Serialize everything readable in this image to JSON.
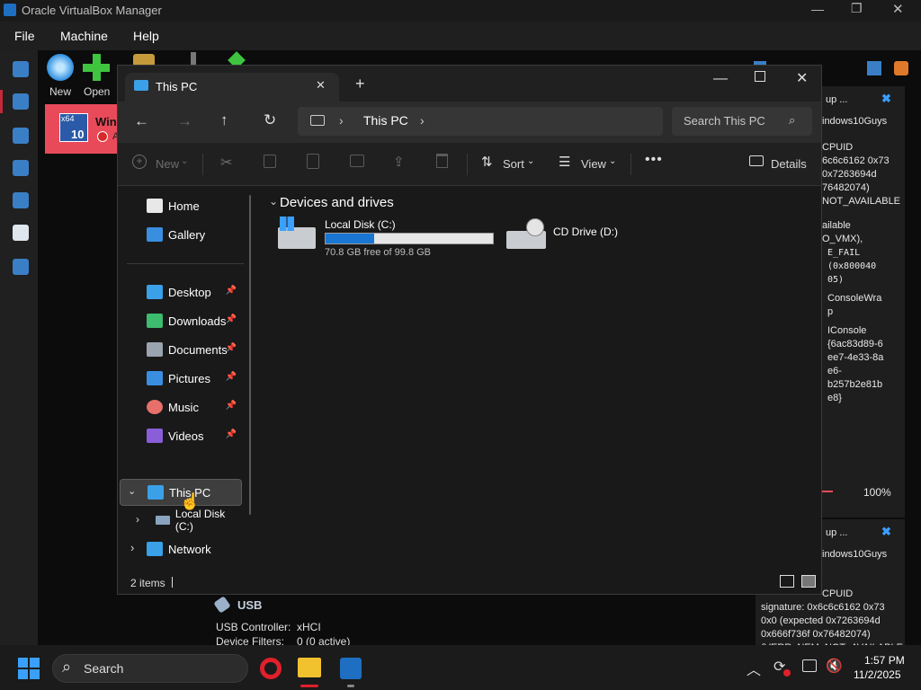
{
  "vbox": {
    "title": "Oracle VirtualBox Manager",
    "menu": [
      "File",
      "Machine",
      "Help"
    ],
    "toolbar": {
      "new_label": "New",
      "open_label": "Open"
    },
    "vm": {
      "badge_top": "x64",
      "badge_num": "10",
      "name_partial": "Wind",
      "state_partial": "A"
    },
    "right_panel_top": {
      "heading": "up ...",
      "lines": [
        "indows10Guys",
        "",
        "CPUID",
        "6c6c6162 0x73",
        "0x7263694d",
        "76482074)",
        "NOT_AVAILABLE",
        "",
        "ailable",
        "O_VMX),"
      ],
      "mono_lines": [
        "E_FAIL",
        "(0x800040",
        "05)"
      ],
      "lines2": [
        "ConsoleWra",
        "p",
        "",
        "IConsole",
        "{6ac83d89-6",
        "ee7-4e33-8a",
        "e6-",
        "b257b2e81b",
        "e8}"
      ],
      "percent": "100%"
    },
    "right_panel_bottom": {
      "heading": "up ...",
      "lines": [
        "indows10Guys",
        "",
        "CPUID",
        "signature: 0x6c6c6162 0x73",
        "0x0 (expected 0x7263694d",
        "0x666f736f 0x76482074)",
        "(VERR_NEM_NOT_AVAILABLE"
      ]
    },
    "usb": {
      "title": "USB",
      "controller_label": "USB Controller:",
      "controller_value": "xHCI",
      "filters_label": "Device Filters:",
      "filters_value": "0 (0 active)"
    }
  },
  "explorer": {
    "tab_title": "This PC",
    "address": {
      "segment": "This PC"
    },
    "search_placeholder": "Search This PC",
    "commands": {
      "new": "New",
      "sort": "Sort",
      "view": "View",
      "details": "Details"
    },
    "nav": {
      "home": "Home",
      "gallery": "Gallery",
      "quick": [
        {
          "label": "Desktop",
          "icon": "desktop-icon",
          "color": "#3aa0e8"
        },
        {
          "label": "Downloads",
          "icon": "download-icon",
          "color": "#3dbb6e"
        },
        {
          "label": "Documents",
          "icon": "document-icon",
          "color": "#9aa4b0"
        },
        {
          "label": "Pictures",
          "icon": "picture-icon",
          "color": "#3a8ee0"
        },
        {
          "label": "Music",
          "icon": "music-icon",
          "color": "#e8706a"
        },
        {
          "label": "Videos",
          "icon": "video-icon",
          "color": "#8a5ed8"
        }
      ],
      "this_pc": "This PC",
      "local_disk": "Local Disk (C:)",
      "network": "Network"
    },
    "section_title": "Devices and drives",
    "drives": [
      {
        "name": "Local Disk (C:)",
        "free_text": "70.8 GB free of 99.8 GB",
        "used_fraction": 0.29
      },
      {
        "name": "CD Drive (D:)"
      }
    ],
    "status": {
      "items": "2 items"
    }
  },
  "taskbar": {
    "search_label": "Search",
    "time": "1:57 PM",
    "date": "11/2/2025"
  },
  "colors": {
    "accent": "#0067c0",
    "vm_item_bg": "#e94a5a",
    "drive_bar": "#1976d2"
  }
}
